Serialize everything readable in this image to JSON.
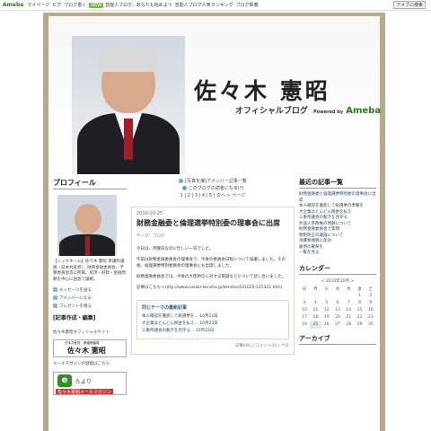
{
  "topbar": {
    "logo": "Ameba",
    "links": [
      "マイページ",
      "ピグ",
      "ブログ書く"
    ],
    "badge": "NEW",
    "promo1": "芸能人ブログ、あなたも始めよう",
    "promo2": "芸能人ブログ人気ランキング",
    "promo3": "ブログ新着",
    "right_btn": "アメブロ検索"
  },
  "header": {
    "title": "佐々木 憲昭",
    "subtitle": "オフィシャルブログ",
    "powered_by": "Powered by",
    "brand": "Ameba"
  },
  "sidebar": {
    "profile_title": "プロフィール",
    "profile_text": "【ニックネーム】佐々木 憲昭 衆議院議員（日本共産党）。財務金融委員会、予算委員会等に所属。経済・財政・金融問題を中心に国会で論戦。",
    "links": [
      "メッセージを送る",
      "アメンバーになる",
      "プレゼントを贈る"
    ],
    "edit_label": "[記事作成・編集]",
    "site_label": "佐々木憲昭オフィシャルサイト",
    "banner_name": "佐々木 憲昭",
    "banner_caption": "日本共産党・衆議院議員",
    "mail_label": "メールマガジンの登録はこちら",
    "mail_title": "たより",
    "mail_sub": "佐々木憲昭メールマガジン"
  },
  "main": {
    "nav1": "[写真を撮]アメンバー記事一覧",
    "nav2": "このブログの読者になる(?)",
    "pager": "1 | 2 | 3 | 4 | 5 | 次へ > ページ",
    "post": {
      "date": "2010-10-25",
      "title": "財務金融委と倫理選挙特別委の理事会に出席",
      "theme": "テーマ：ブログ",
      "paragraphs": [
        "今日は、月曜日なのに忙しい一日でした。",
        "午前は財務金融委員会の理事会で、今後の委員会日程について協議しました。その後、倫理選挙特別委員会の理事会にも出席しました。",
        "財務金融委員会では、今後の大臣所信に対する質疑などについて話し合いました。",
        "記事はこちら→ http://www.sasaki-kensho.jp/kensho/101025-125321.html"
      ],
      "foot": "記事URL | コメント(0) | ペタ(0)"
    },
    "theme_box": {
      "header": "同じテーマの最新記事",
      "rows": [
        "本人確認を徹底して総選挙を… 10月24日",
        "大企業はどんどん税金を払え… 10月23日",
        "三重県議会の動きを見守る… 10月22日"
      ]
    },
    "bottom_meta": "記事URL | コメント(0) | ペタ"
  },
  "right": {
    "recent_title": "最近の記事一覧",
    "recent": [
      "財務金融委と倫理選挙特別委の理事会に出席",
      "本人確認を徹底して総選挙の準備を",
      "大企業はどんどん税金を払え",
      "三重県議会の動きを見守る",
      "外国人参政権の問題について",
      "財務金融委員会で質問",
      "税制改正の議論について",
      "消費税増税に反対",
      "雇用の確保を",
      "一覧を見る"
    ],
    "calendar_title": "カレンダー",
    "calendar_month": "< 2010年10月 >",
    "weekdays": [
      "日",
      "月",
      "火",
      "水",
      "木",
      "金",
      "土"
    ],
    "weeks": [
      [
        "",
        "",
        "",
        "",
        "",
        "1",
        "2"
      ],
      [
        "3",
        "4",
        "5",
        "6",
        "7",
        "8",
        "9"
      ],
      [
        "10",
        "11",
        "12",
        "13",
        "14",
        "15",
        "16"
      ],
      [
        "17",
        "18",
        "19",
        "20",
        "21",
        "22",
        "23"
      ],
      [
        "24",
        "25",
        "26",
        "27",
        "28",
        "29",
        "30"
      ]
    ],
    "archive_title": "アーカイブ"
  }
}
